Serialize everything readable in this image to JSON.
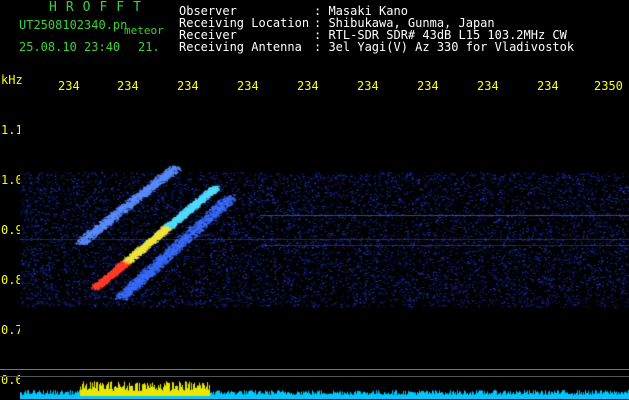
{
  "header": {
    "app_title": "HROFFT",
    "file_name": "UT2508102340.pn",
    "meteor_label": "meteor",
    "datetime": "25.08.10 23:40",
    "count": "21.",
    "rows": [
      {
        "label": "Observer",
        "value": ": Masaki Kano"
      },
      {
        "label": "Receiving Location",
        "value": ": Shibukawa, Gunma, Japan"
      },
      {
        "label": "Receiver",
        "value": ": RTL-SDR SDR# 43dB L15 103.2MHz CW"
      },
      {
        "label": "Receiving Antenna",
        "value": ": 3el Yagi(V) Az 330 for Vladivostok"
      }
    ]
  },
  "axes": {
    "unit": "kHz",
    "x_ticks": [
      "234",
      "234",
      "234",
      "234",
      "234",
      "234",
      "234",
      "234",
      "234",
      "2350"
    ],
    "y_ticks": [
      "1.1",
      "1.0",
      "0.9",
      "0.8",
      "0.7",
      "0.6"
    ]
  },
  "colors": {
    "title_green": "#3ad13a",
    "text_white": "#ffffff",
    "tick_yellow": "#ffff00",
    "background": "#000000",
    "noise_blue": "#1f3cff",
    "bottom_band_cyan": "#00c8ff",
    "bottom_band_yellow": "#e8e800"
  }
}
